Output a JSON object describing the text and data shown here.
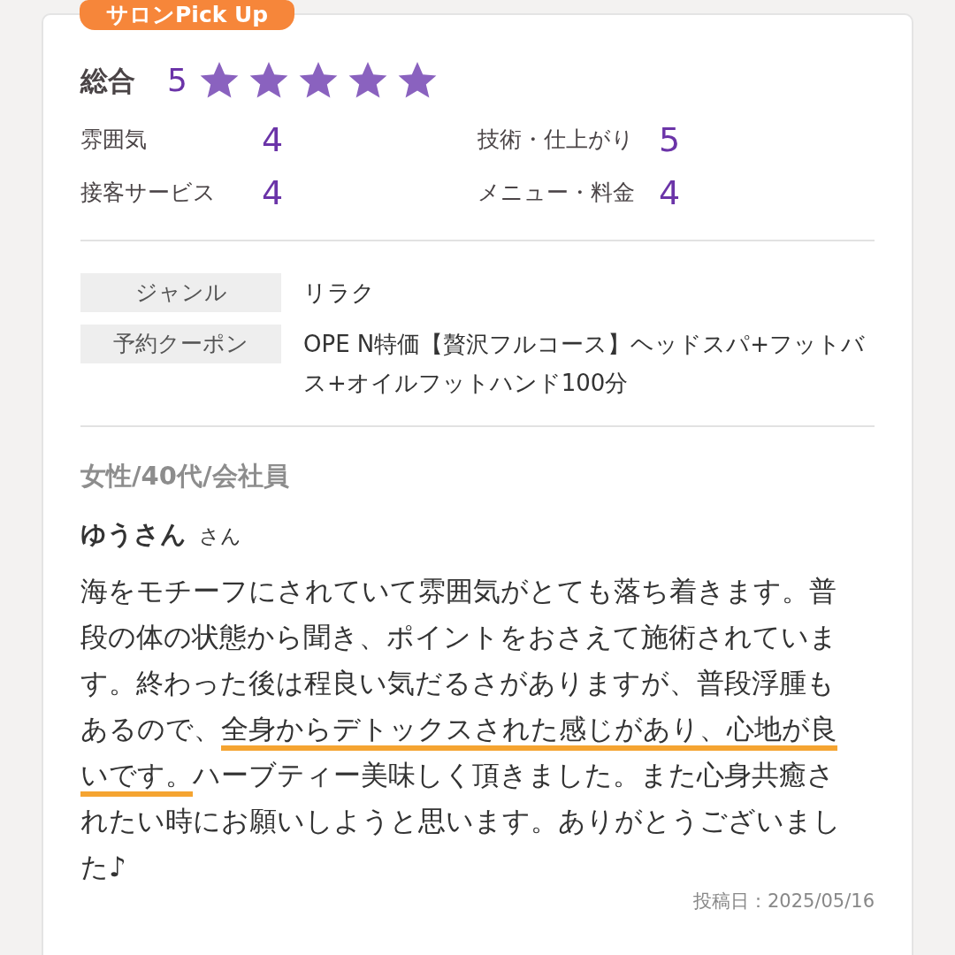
{
  "badge": "サロンPick Up",
  "overall": {
    "label": "総合",
    "score": "5",
    "stars": 5
  },
  "ratings": [
    {
      "label": "雰囲気",
      "score": "4"
    },
    {
      "label": "技術・仕上がり",
      "score": "5"
    },
    {
      "label": "接客サービス",
      "score": "4"
    },
    {
      "label": "メニュー・料金",
      "score": "4"
    }
  ],
  "details": [
    {
      "label": "ジャンル",
      "value": "リラク"
    },
    {
      "label": "予約クーポン",
      "value": "OPE N特価【贅沢フルコース】ヘッドスパ+フットバス+オイルフットハンド100分"
    }
  ],
  "reviewer": {
    "profile": "女性/40代/会社員",
    "name": "ゆうさん",
    "honorific": "さん"
  },
  "review": [
    {
      "text": "海をモチーフにされていて雰囲気がとても落ち着きます。普段の体の状態から聞き、ポイントをおさえて施術されています。終わった後は程良い気だるさがありますが、普段浮腫もあるので、",
      "highlighted": false
    },
    {
      "text": "全身からデトックスされた感じがあり、心地が良いです。",
      "highlighted": true
    },
    {
      "text": "ハーブティー美味しく頂きました。また心身共癒されたい時にお願いしようと思います。ありがとうございました♪",
      "highlighted": false
    }
  ],
  "posted": "投稿日：2025/05/16"
}
